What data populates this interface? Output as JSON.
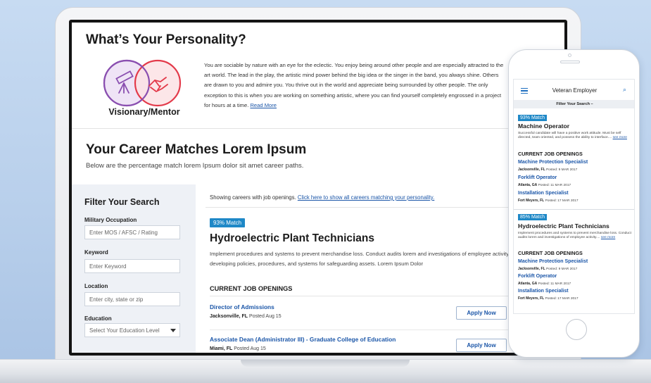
{
  "personality": {
    "title": "What’s Your Personality?",
    "type_label": "Visionary/Mentor",
    "description": "You are sociable by nature with an eye for the eclectic. You enjoy being around other people and are especially attracted to the art world. The lead in the play, the artistic mind power behind the big idea or the singer in the band, you always shine. Others are drawn to you and admire you. You thrive out in the world and appreciate being surrounded by other people. The only exception to this is when you are working on something artistic, where you can find yourself completely engrossed in a project for hours at a time.",
    "read_more": "Read More",
    "venn_colors": {
      "left": "#8a4fb0",
      "right": "#e33a4a"
    }
  },
  "career": {
    "title": "Your Career Matches Lorem Ipsum",
    "subtitle": "Below are the percentage match lorem Ipsum dolor sit amet career paths."
  },
  "filter": {
    "title": "Filter Your Search",
    "military_label": "Military Occupation",
    "military_placeholder": "Enter MOS / AFSC / Rating",
    "keyword_label": "Keyword",
    "keyword_placeholder": "Enter Keyword",
    "location_label": "Location",
    "location_placeholder": "Enter city, state or zip",
    "education_label": "Education",
    "education_value": "Select Your Education Level"
  },
  "results": {
    "showing_text": "Showing careers with job openings.",
    "showing_link": "Click here to show all careers matching your personality.",
    "match": "93% Match",
    "job_title": "Hydroelectric Plant Technicians",
    "job_desc": "Implement procedures and systems to prevent merchandise loss. Conduct audits lorem and investigations of employee activity. May assist in developing policies, procedures, and systems for safeguarding assets. Lorem Ipsum Dolor",
    "openings_heading": "CURRENT JOB OPENINGS",
    "apply_label": "Apply Now",
    "openings": [
      {
        "title": "Director of Admissions",
        "location": "Jacksonville, FL",
        "posted": "Posted Aug 15"
      },
      {
        "title": "Associate Dean (Administrator III) - Graduate College of Education",
        "location": "Miami, FL",
        "posted": "Posted Aug 15"
      }
    ]
  },
  "phone": {
    "brand": "Veteran Employer",
    "filter_bar": "Filter Your Search –",
    "openings_heading": "CURRENT JOB OPENINGS",
    "see_more": "see more",
    "cards": [
      {
        "match": "93% Match",
        "title": "Machine Operator",
        "desc": "Successful candidate will have a positive work attitude. Must be self directed, team oriented, and possess the ability to interface....",
        "openings": [
          {
            "title": "Machine Protection Specialist",
            "location": "Jacksonville, FL",
            "posted": "Posted: 9 MAR 2017"
          },
          {
            "title": "Forklift Operator",
            "location": "Atlanta, GA",
            "posted": "Posted: 11 MAR 2017"
          },
          {
            "title": "Installation Specialist",
            "location": "Fort Meyers, FL",
            "posted": "Posted: 17 MAR 2017"
          }
        ]
      },
      {
        "match": "85% Match",
        "title": "Hydroelectric Plant Technicians",
        "desc": "Implement procedures and systems to prevent merchandise loss. Conduct audits lorem and investigations of employee activity....",
        "openings": [
          {
            "title": "Machine Protection Specialist",
            "location": "Jacksonville, FL",
            "posted": "Posted: 9 MAR 2017"
          },
          {
            "title": "Forklift Operator",
            "location": "Atlanta, GA",
            "posted": "Posted: 11 MAR 2017"
          },
          {
            "title": "Installation Specialist",
            "location": "Fort Meyers, FL",
            "posted": "Posted: 17 MAR 2017"
          }
        ]
      }
    ]
  },
  "colors": {
    "accent": "#1b56a8",
    "badge": "#1e88c7"
  }
}
